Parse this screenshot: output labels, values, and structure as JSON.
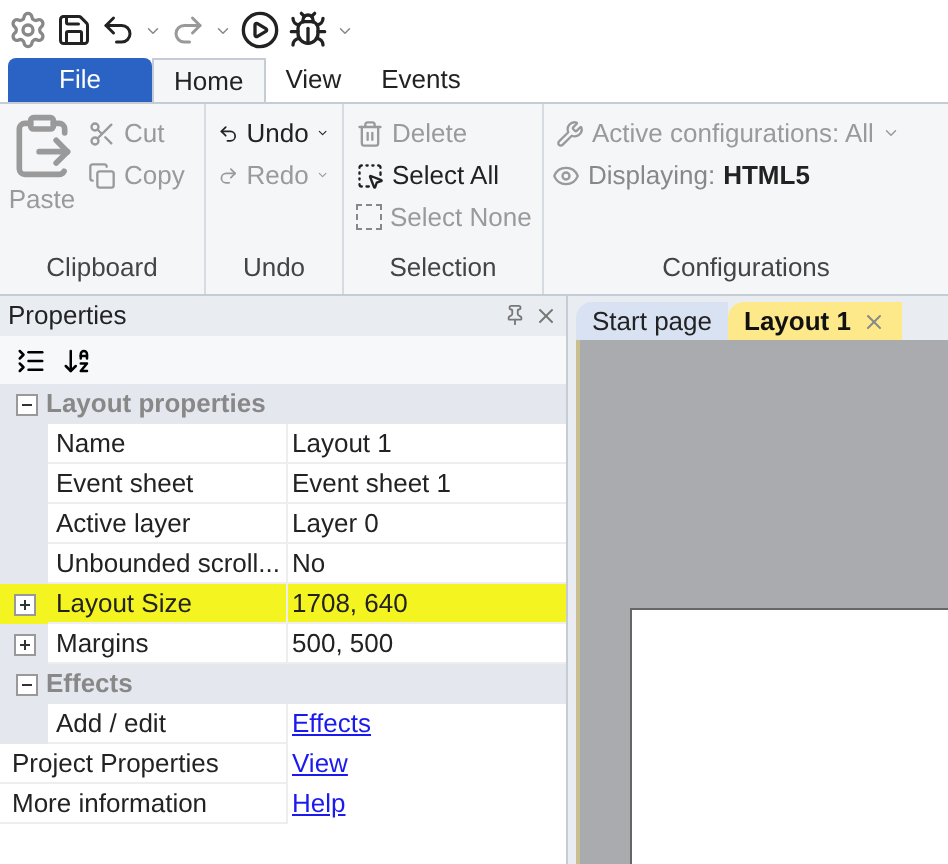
{
  "ribbon_tabs": [
    {
      "label": "File",
      "kind": "file",
      "selected": false
    },
    {
      "label": "Home",
      "kind": "tab",
      "selected": true
    },
    {
      "label": "View",
      "kind": "tab",
      "selected": false
    },
    {
      "label": "Events",
      "kind": "tab",
      "selected": false
    }
  ],
  "ribbon": {
    "clipboard": {
      "label": "Clipboard",
      "paste": {
        "label": "Paste",
        "disabled": true
      },
      "cut": {
        "label": "Cut",
        "disabled": true
      },
      "copy": {
        "label": "Copy",
        "disabled": true
      }
    },
    "undo": {
      "label": "Undo",
      "undo": {
        "label": "Undo",
        "disabled": false
      },
      "redo": {
        "label": "Redo",
        "disabled": true
      }
    },
    "selection": {
      "label": "Selection",
      "delete": {
        "label": "Delete",
        "disabled": true
      },
      "select_all": {
        "label": "Select All",
        "disabled": false
      },
      "select_none": {
        "label": "Select None",
        "disabled": true
      }
    },
    "configurations": {
      "label": "Configurations",
      "active": {
        "label": "Active configurations: All",
        "disabled": true
      },
      "displaying": {
        "label": "Displaying:",
        "value": "HTML5"
      }
    }
  },
  "properties": {
    "title": "Properties",
    "rows": [
      {
        "kind": "section",
        "label": "Layout properties",
        "expanded": true
      },
      {
        "kind": "prop",
        "label": "Name",
        "value": "Layout 1"
      },
      {
        "kind": "prop",
        "label": "Event sheet",
        "value": "Event sheet 1"
      },
      {
        "kind": "prop",
        "label": "Active layer",
        "value": "Layer 0"
      },
      {
        "kind": "prop",
        "label": "Unbounded scroll...",
        "value": "No"
      },
      {
        "kind": "group",
        "label": "Layout Size",
        "value": "1708, 640",
        "expanded": false,
        "highlighted": true
      },
      {
        "kind": "group",
        "label": "Margins",
        "value": "500, 500",
        "expanded": false,
        "highlighted": false
      },
      {
        "kind": "section",
        "label": "Effects",
        "expanded": true
      },
      {
        "kind": "link",
        "label": "Add / edit",
        "value": "Effects"
      },
      {
        "kind": "toplink",
        "label": "Project Properties",
        "value": "View"
      },
      {
        "kind": "toplink",
        "label": "More information",
        "value": "Help"
      }
    ]
  },
  "doc_tabs": [
    {
      "label": "Start page",
      "selected": false,
      "closable": false
    },
    {
      "label": "Layout 1",
      "selected": true,
      "closable": true
    }
  ]
}
